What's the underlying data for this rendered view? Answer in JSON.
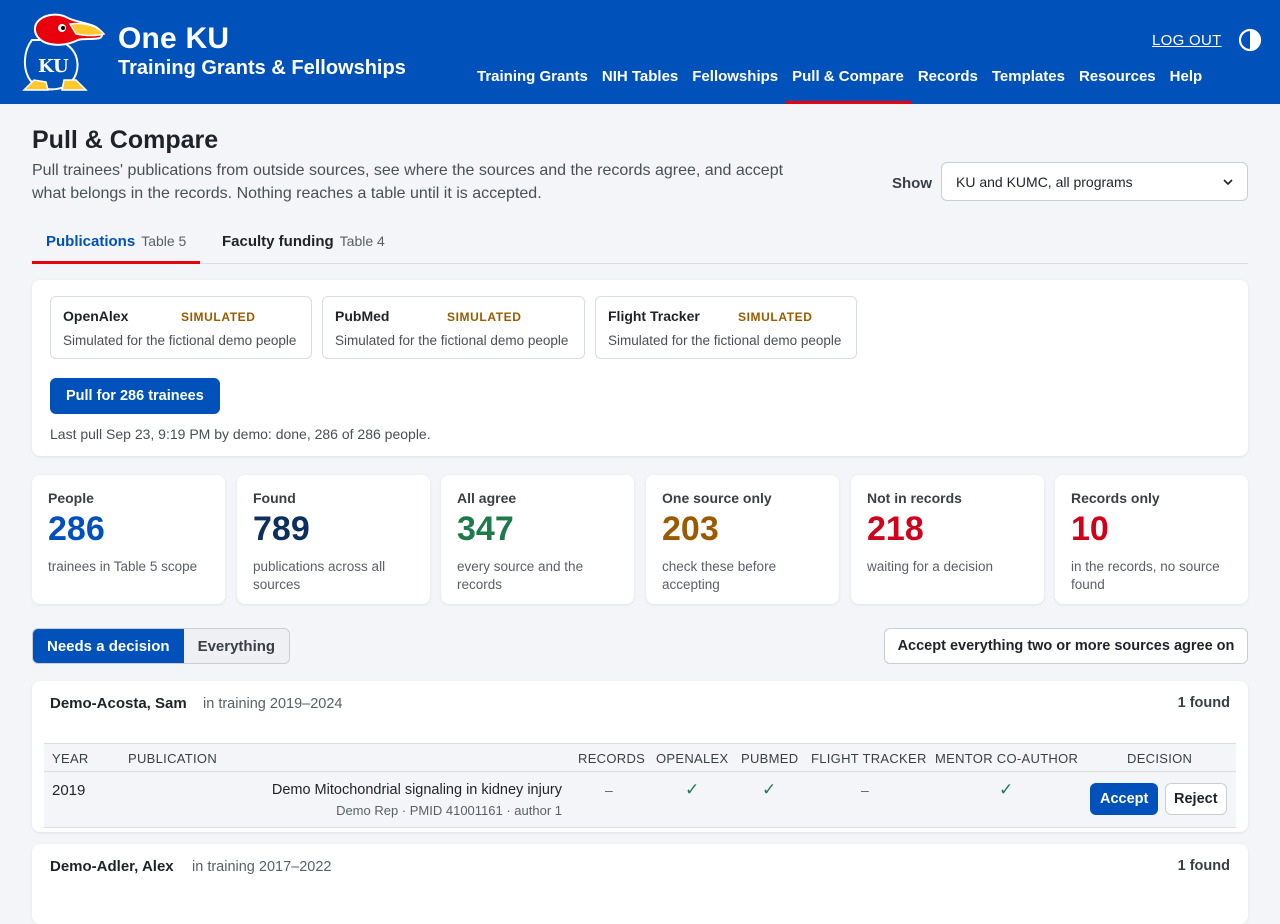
{
  "brand": {
    "title": "One KU",
    "subtitle": "Training Grants & Fellowships"
  },
  "header": {
    "logout": "LOG OUT",
    "nav": [
      "Training Grants",
      "NIH Tables",
      "Fellowships",
      "Pull & Compare",
      "Records",
      "Templates",
      "Resources",
      "Help"
    ],
    "active_nav": "Pull & Compare"
  },
  "page": {
    "title": "Pull & Compare",
    "description": "Pull trainees' publications from outside sources, see where the sources and the records agree, and accept what belongs in the records. Nothing reaches a table until it is accepted.",
    "show_label": "Show",
    "show_value": "KU and KUMC, all programs"
  },
  "tabs": [
    {
      "label": "Publications",
      "sub": "Table 5",
      "active": true
    },
    {
      "label": "Faculty funding",
      "sub": "Table 4",
      "active": false
    }
  ],
  "sources": [
    {
      "name": "OpenAlex",
      "tag": "SIMULATED",
      "desc": "Simulated for the fictional demo people"
    },
    {
      "name": "PubMed",
      "tag": "SIMULATED",
      "desc": "Simulated for the fictional demo people"
    },
    {
      "name": "Flight Tracker",
      "tag": "SIMULATED",
      "desc": "Simulated for the fictional demo people"
    }
  ],
  "pull": {
    "button": "Pull for 286 trainees",
    "last_pull": "Last pull Sep 23, 9:19 PM by demo: done, 286 of 286 people."
  },
  "stats": [
    {
      "label": "People",
      "value": "286",
      "note": "trainees in Table 5 scope",
      "color": "#0051ba"
    },
    {
      "label": "Found",
      "value": "789",
      "note": "publications across all sources",
      "color": "#0c2f5e"
    },
    {
      "label": "All agree",
      "value": "347",
      "note": "every source and the records",
      "color": "#1e7a4a"
    },
    {
      "label": "One source only",
      "value": "203",
      "note": "check these before accepting",
      "color": "#9a5b00"
    },
    {
      "label": "Not in records",
      "value": "218",
      "note": "waiting for a decision",
      "color": "#d0021b"
    },
    {
      "label": "Records only",
      "value": "10",
      "note": "in the records, no source found",
      "color": "#d0021b"
    }
  ],
  "filter": {
    "needs_decision": "Needs a decision",
    "everything": "Everything",
    "accept_all": "Accept everything two or more sources agree on"
  },
  "table_headers": [
    "YEAR",
    "PUBLICATION",
    "RECORDS",
    "OPENALEX",
    "PUBMED",
    "FLIGHT TRACKER",
    "MENTOR CO-AUTHOR",
    "DECISION"
  ],
  "people": [
    {
      "name": "Demo-Acosta, Sam",
      "meta": "in training 2019–2024",
      "count": "1 found",
      "rows": [
        {
          "year": "2019",
          "title": "Demo Mitochondrial signaling in kidney injury",
          "meta": "Demo Rep · PMID 41001161 · author 1",
          "records": "–",
          "openalex": "✓",
          "pubmed": "✓",
          "flight_tracker": "–",
          "mentor": "✓",
          "accept": "Accept",
          "reject": "Reject"
        }
      ]
    },
    {
      "name": "Demo-Adler, Alex",
      "meta": "in training 2017–2022",
      "count": "1 found"
    }
  ]
}
